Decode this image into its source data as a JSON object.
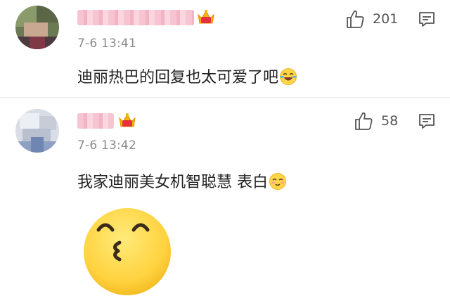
{
  "comments": [
    {
      "timestamp": "7-6 13:41",
      "text": "迪丽热巴的回复也太可爱了吧",
      "emoji": "laughing-crying-emoji",
      "likes": "201"
    },
    {
      "timestamp": "7-6 13:42",
      "text": "我家迪丽美女机智聪慧 表白",
      "emoji": "blushing-smile-emoji",
      "likes": "58"
    }
  ],
  "big_sticker": "kissing-face-emoji",
  "colors": {
    "accent_crown": "#e6313c",
    "crown_gold": "#f4b400",
    "emoji_yellow": "#ffd54a"
  }
}
